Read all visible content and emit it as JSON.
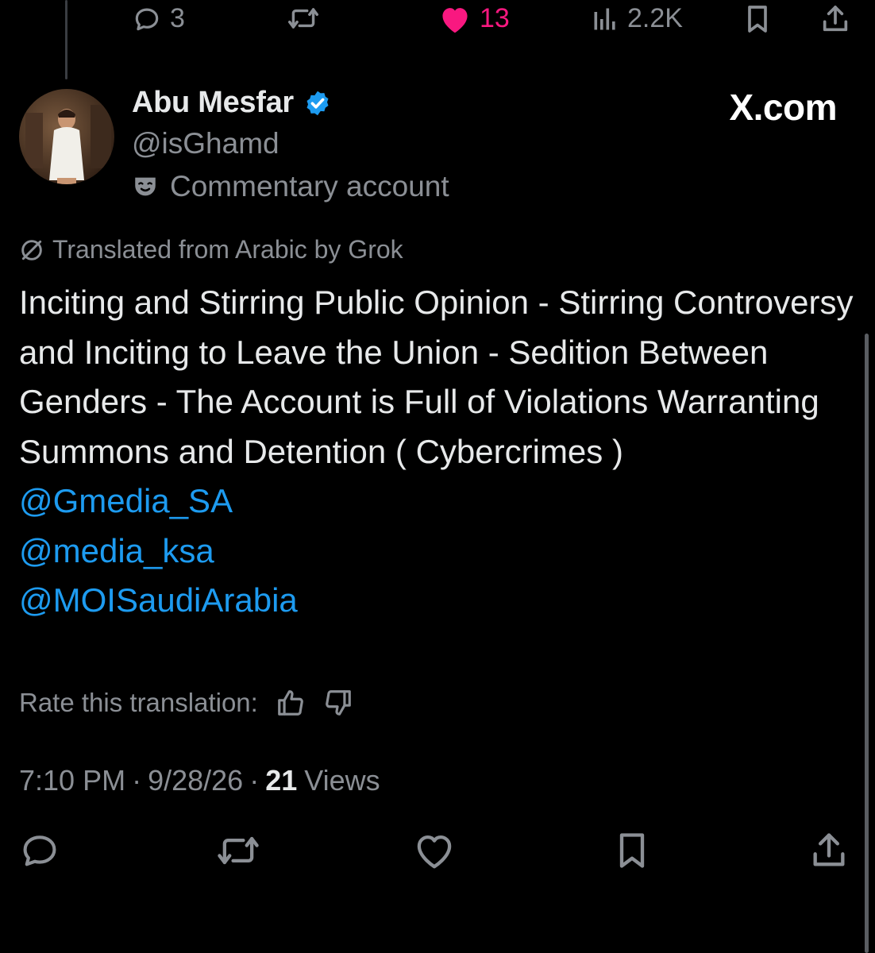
{
  "top_stats": {
    "replies": "3",
    "likes": "13",
    "views": "2.2K"
  },
  "author": {
    "name": "Abu Mesfar",
    "handle": "@isGhamd",
    "account_label": "Commentary account",
    "verified": true
  },
  "brand": "X.com",
  "translation": {
    "note": "Translated from Arabic by Grok",
    "rate_label": "Rate this translation:"
  },
  "tweet": {
    "text": "Inciting and Stirring Public Opinion - Stirring Controversy and Inciting to Leave the Union - Sedition Between Genders - The Account is Full of Violations Warranting Summons and Detention ( Cybercrimes )",
    "mentions": [
      "@Gmedia_SA",
      "@media_ksa",
      "@MOISaudiArabia"
    ]
  },
  "meta": {
    "time": "7:10 PM",
    "date": "9/28/26",
    "separator": "·",
    "views_count": "21",
    "views_label": "Views"
  },
  "colors": {
    "background": "#000000",
    "text": "#e7e9ea",
    "muted": "#8b8f95",
    "link": "#1d9bf0",
    "like": "#f91880",
    "verified": "#1d9bf0"
  }
}
